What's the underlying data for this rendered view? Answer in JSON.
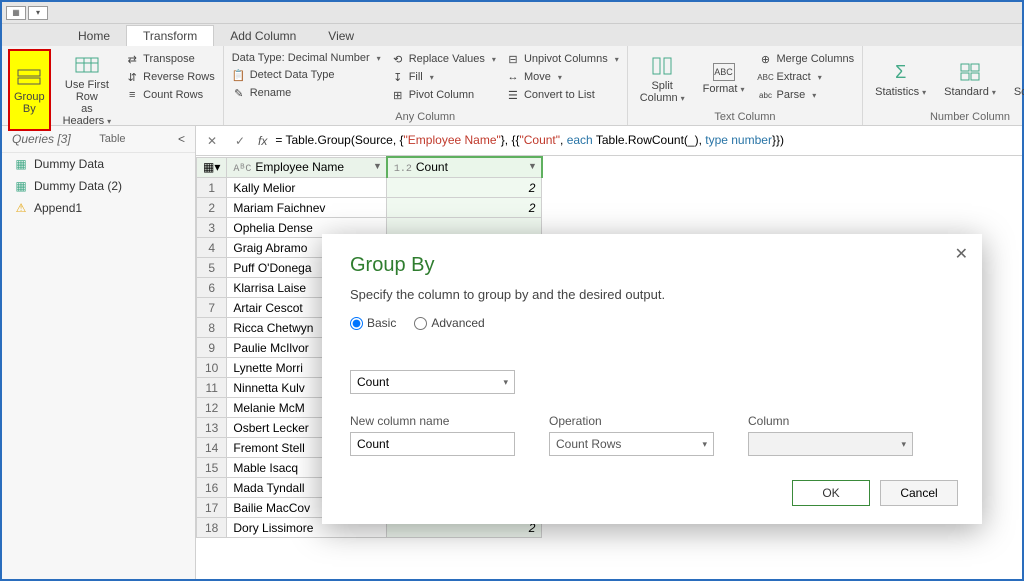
{
  "tabs": [
    "Home",
    "Transform",
    "Add Column",
    "View"
  ],
  "active_tab": "Transform",
  "ribbon": {
    "group_by": "Group\nBy",
    "use_first_row": "Use First Row\nas Headers",
    "transpose": "Transpose",
    "reverse_rows": "Reverse Rows",
    "count_rows": "Count Rows",
    "table_group": "Table",
    "data_type": "Data Type: Decimal Number",
    "detect": "Detect Data Type",
    "rename": "Rename",
    "replace": "Replace Values",
    "fill": "Fill",
    "pivot": "Pivot Column",
    "unpivot": "Unpivot Columns",
    "move": "Move",
    "convert": "Convert to List",
    "any_column_group": "Any Column",
    "split": "Split\nColumn",
    "format": "Format",
    "merge": "Merge Columns",
    "extract": "Extract",
    "parse": "Parse",
    "text_group": "Text Column",
    "statistics": "Statistics",
    "standard": "Standard",
    "scientific": "Scientific",
    "number_group": "Number Column"
  },
  "queries": {
    "header": "Queries [3]",
    "items": [
      {
        "name": "Dummy Data",
        "icon": "table"
      },
      {
        "name": "Dummy Data (2)",
        "icon": "table"
      },
      {
        "name": "Append1",
        "icon": "warn"
      }
    ]
  },
  "formula": {
    "prefix": "= Table.Group(Source, {",
    "s1": "\"Employee Name\"",
    "mid1": "}, {{",
    "s2": "\"Count\"",
    "mid2": ", ",
    "kw1": "each",
    "mid3": " Table.RowCount(_), ",
    "kw2": "type number",
    "suffix": "}})"
  },
  "columns": {
    "emp": "Employee Name",
    "emp_type": "AᴮC",
    "cnt": "Count",
    "cnt_type": "1.2"
  },
  "rows": [
    {
      "n": 1,
      "emp": "Kally Melior",
      "cnt": "2"
    },
    {
      "n": 2,
      "emp": "Mariam Faichnev",
      "cnt": "2"
    },
    {
      "n": 3,
      "emp": "Ophelia Dense",
      "cnt": ""
    },
    {
      "n": 4,
      "emp": "Graig Abramo",
      "cnt": ""
    },
    {
      "n": 5,
      "emp": "Puff O'Donega",
      "cnt": ""
    },
    {
      "n": 6,
      "emp": "Klarrisa Laise",
      "cnt": ""
    },
    {
      "n": 7,
      "emp": "Artair Cescot",
      "cnt": ""
    },
    {
      "n": 8,
      "emp": "Ricca Chetwyn",
      "cnt": ""
    },
    {
      "n": 9,
      "emp": "Paulie McIlvor",
      "cnt": ""
    },
    {
      "n": 10,
      "emp": "Lynette Morri",
      "cnt": ""
    },
    {
      "n": 11,
      "emp": "Ninnetta Kulv",
      "cnt": ""
    },
    {
      "n": 12,
      "emp": "Melanie McM",
      "cnt": ""
    },
    {
      "n": 13,
      "emp": "Osbert Lecker",
      "cnt": ""
    },
    {
      "n": 14,
      "emp": "Fremont Stell",
      "cnt": ""
    },
    {
      "n": 15,
      "emp": "Mable Isacq",
      "cnt": ""
    },
    {
      "n": 16,
      "emp": "Mada Tyndall",
      "cnt": ""
    },
    {
      "n": 17,
      "emp": "Bailie MacCov",
      "cnt": ""
    },
    {
      "n": 18,
      "emp": "Dory Lissimore",
      "cnt": "2"
    }
  ],
  "dialog": {
    "title": "Group By",
    "desc": "Specify the column to group by and the desired output.",
    "basic": "Basic",
    "advanced": "Advanced",
    "groupby_col": "Count",
    "new_col_label": "New column name",
    "new_col_value": "Count",
    "operation_label": "Operation",
    "operation_value": "Count Rows",
    "column_label": "Column",
    "column_value": "",
    "ok": "OK",
    "cancel": "Cancel"
  }
}
